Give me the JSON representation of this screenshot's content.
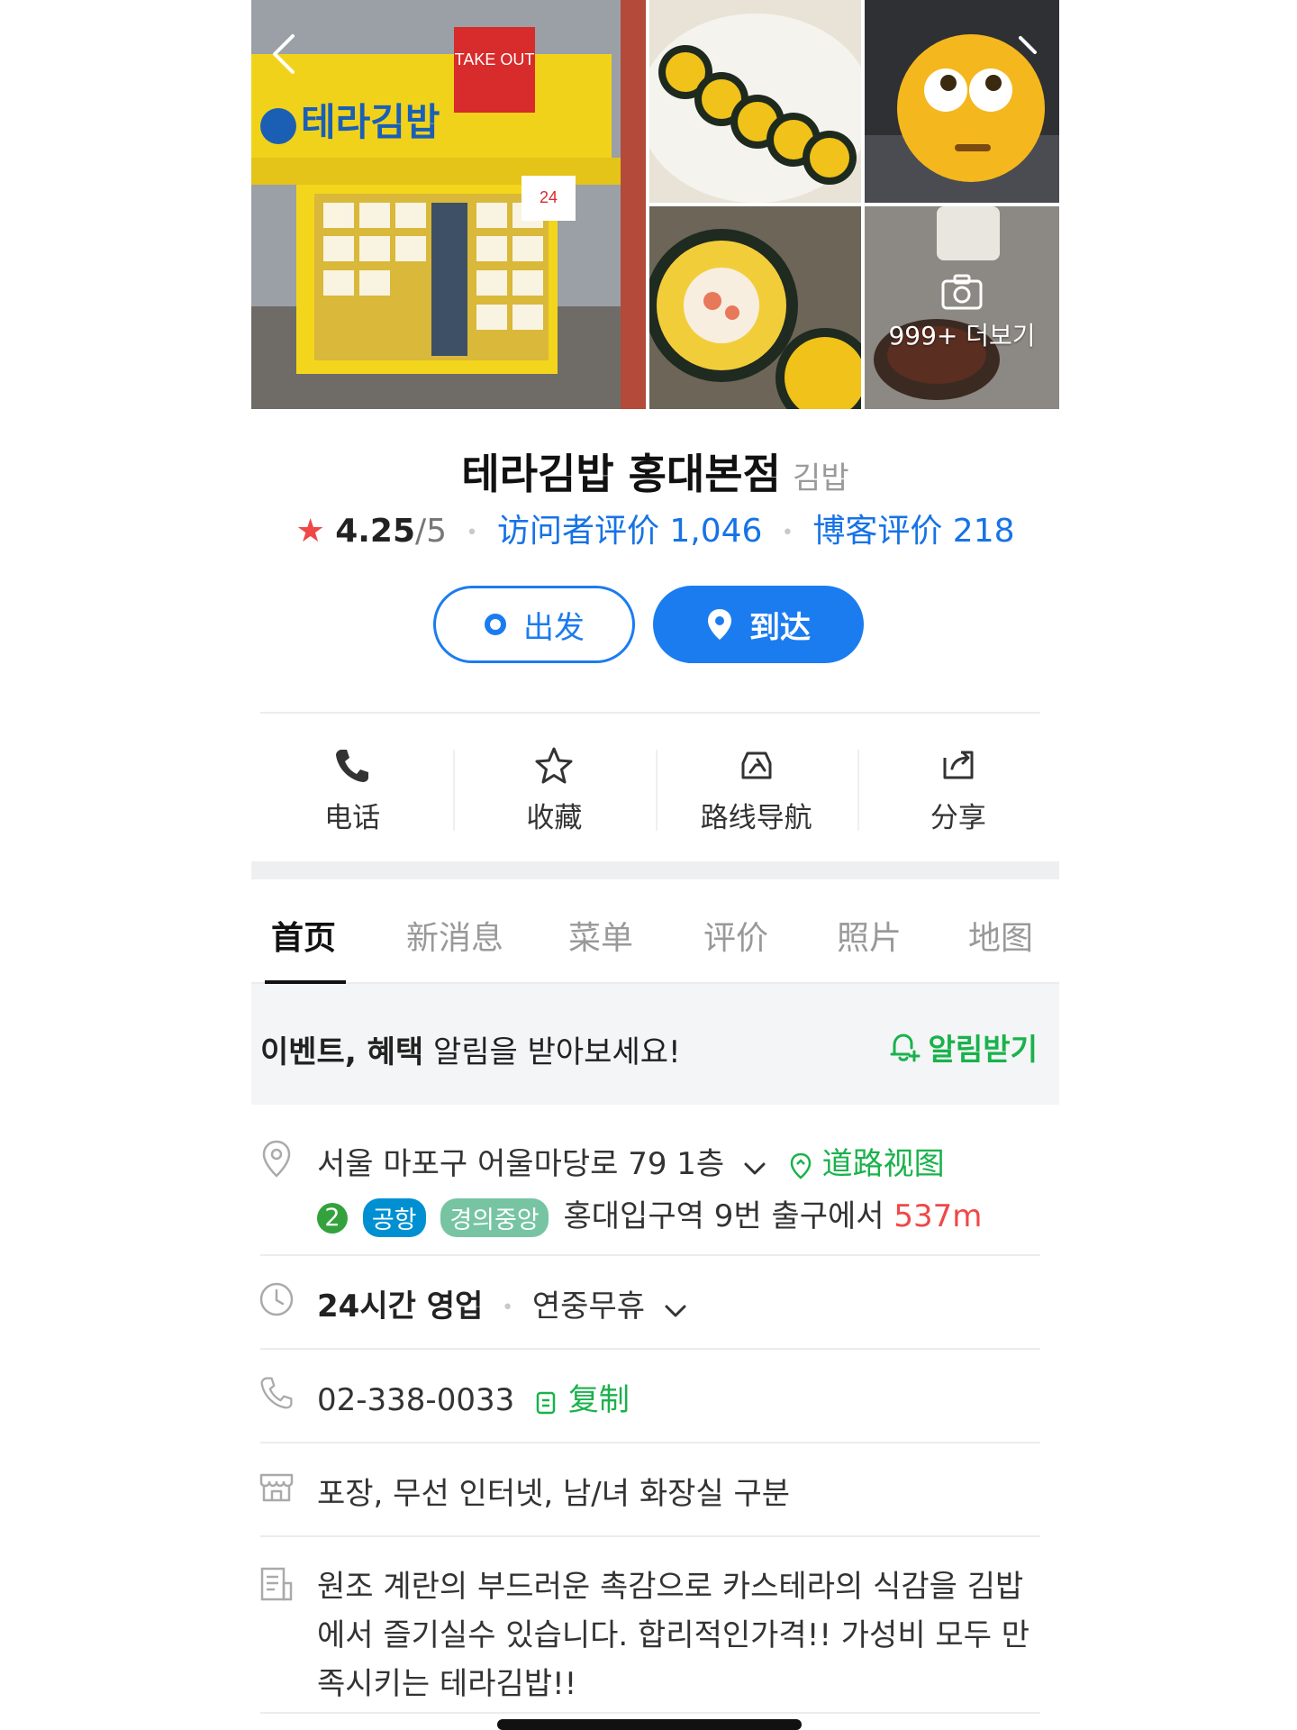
{
  "photos": {
    "more_label": "999+ 더보기",
    "storefront_sign": "테라김밥",
    "sign_takeout": "TAKE OUT",
    "sign_24": "24시 영업"
  },
  "place": {
    "name": "테라김밥 홍대본점",
    "category": "김밥",
    "rating": "4.25",
    "rating_max": "/5",
    "visitor_reviews": "访问者评价 1,046",
    "blog_reviews": "博客评价 218"
  },
  "buttons": {
    "depart": "出发",
    "arrive": "到达"
  },
  "actions": [
    {
      "label": "电话",
      "icon": "phone-icon"
    },
    {
      "label": "收藏",
      "icon": "star-icon"
    },
    {
      "label": "路线导航",
      "icon": "car-route-icon"
    },
    {
      "label": "分享",
      "icon": "share-icon"
    }
  ],
  "tabs": [
    "首页",
    "新消息",
    "菜单",
    "评价",
    "照片",
    "地图"
  ],
  "active_tab": "首页",
  "notice": {
    "bold": "이벤트, 혜택",
    "rest": " 알림을 받아보세요!",
    "button": "알림받기"
  },
  "info": {
    "address": "서울 마포구 어울마당로 79 1층",
    "road_view": "道路视图",
    "subway_line": "2",
    "badge_airport": "공항",
    "badge_gyeongui": "경의중앙",
    "station": "홍대입구역 9번 출구에서",
    "distance": "537m",
    "hours_bold": "24시간 영업",
    "hours_extra": "연중무휴",
    "phone": "02-338-0033",
    "copy": "复制",
    "amenities": "포장, 무선 인터넷, 남/녀 화장실 구분",
    "description": "원조 계란의 부드러운 촉감으로 카스테라의 식감을 김밥에서 즐기실수 있습니다. 합리적인가격!! 가성비 모두 만족시키는 테라김밥!!"
  },
  "colors": {
    "primary_blue": "#1b7cf0",
    "link_blue": "#1673e6",
    "green": "#19b24b",
    "red": "#f04747",
    "tab_active": "#111111"
  }
}
